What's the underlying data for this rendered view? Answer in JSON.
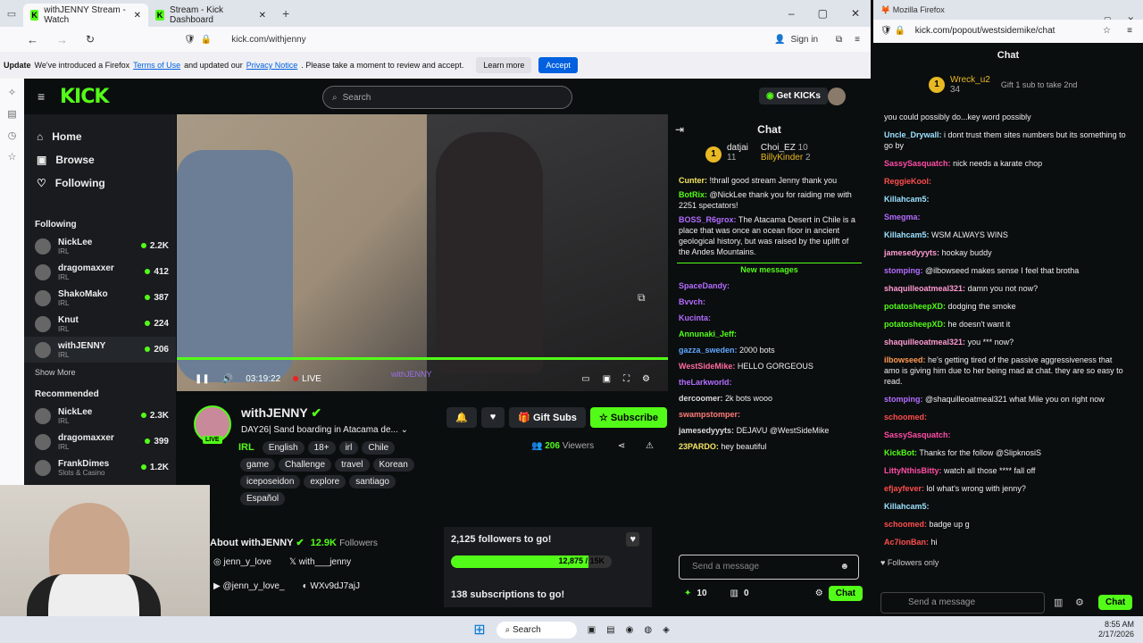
{
  "browser": {
    "tabs": [
      {
        "label": "withJENNY Stream - Watch"
      },
      {
        "label": "Stream - Kick Dashboard"
      }
    ],
    "url": "kick.com/withjenny",
    "sign_in": "Sign in",
    "notice": {
      "update": "Update",
      "text1": "We've introduced a Firefox",
      "terms": "Terms of Use",
      "text2": "and updated our",
      "privacy": "Privacy Notice",
      "text3": ". Please take a moment to review and accept.",
      "learn": "Learn more",
      "accept": "Accept"
    }
  },
  "kick": {
    "logo": "KICK",
    "search_placeholder": "Search",
    "getkicks": "Get KICKs",
    "nav": [
      {
        "label": "Home"
      },
      {
        "label": "Browse"
      },
      {
        "label": "Following"
      }
    ],
    "following_title": "Following",
    "following": [
      {
        "name": "NickLee",
        "cat": "IRL",
        "count": "2.2K"
      },
      {
        "name": "dragomaxxer",
        "cat": "IRL",
        "count": "412"
      },
      {
        "name": "ShakoMako",
        "cat": "IRL",
        "count": "387"
      },
      {
        "name": "Knut",
        "cat": "IRL",
        "count": "224"
      },
      {
        "name": "withJENNY",
        "cat": "IRL",
        "count": "206"
      }
    ],
    "show_more": "Show More",
    "recommended_title": "Recommended",
    "recommended": [
      {
        "name": "NickLee",
        "cat": "IRL",
        "count": "2.3K"
      },
      {
        "name": "dragomaxxer",
        "cat": "IRL",
        "count": "399"
      },
      {
        "name": "FrankDimes",
        "cat": "Slots & Casino",
        "count": "1.2K"
      }
    ],
    "player": {
      "time": "03:19:22",
      "live": "LIVE",
      "watermark": "withJENNY"
    },
    "stream": {
      "name": "withJENNY",
      "live_badge": "LIVE",
      "title": "DAY26| Sand boarding in Atacama de...",
      "category": "IRL",
      "tags": [
        "English",
        "18+",
        "irl",
        "Chile",
        "game",
        "Challenge",
        "travel",
        "Korean",
        "iceposeidon",
        "explore",
        "santiago",
        "Español"
      ],
      "viewers": "206",
      "viewers_label": "Viewers",
      "gift": "Gift Subs",
      "subscribe": "Subscribe"
    },
    "about": {
      "title": "About withJENNY",
      "followers": "12.9K",
      "followers_label": "Followers",
      "ig": "jenn_y_love",
      "x": "with___jenny",
      "yt": "@jenn_y_love_",
      "discord": "WXv9dJ7ajJ"
    },
    "goal": {
      "followers_text": "2,125 followers to go!",
      "progress_label": "12,875 / 15K",
      "progress": 0.858,
      "subs_text": "138 subscriptions to go!"
    },
    "chat": {
      "title": "Chat",
      "top": [
        {
          "name": "datjai",
          "n": "11"
        },
        {
          "name": "Choi_EZ",
          "n": "10"
        },
        {
          "name": "BillyKinder",
          "n": "2"
        }
      ],
      "messages": [
        {
          "user": "Cunter:",
          "text": "!thrall good stream Jenny thank you",
          "color": "#f5e663"
        },
        {
          "user": "BotRix:",
          "text": "@NickLee thank you for raiding me with 2251 spectators!",
          "color": "#53fc18"
        },
        {
          "user": "BOSS_R6grox:",
          "text": "The Atacama Desert in Chile is a place that was once an ocean floor in ancient geological history, but was raised by the uplift of the Andes Mountains.",
          "color": "#b36cff"
        }
      ],
      "new_messages": "New messages",
      "new": [
        {
          "user": "SpaceDandy:",
          "text": "",
          "color": "#b36cff"
        },
        {
          "user": "Bvvch:",
          "text": "",
          "color": "#b36cff"
        },
        {
          "user": "Kucinta:",
          "text": "",
          "color": "#b36cff"
        },
        {
          "user": "Annunaki_Jeff:",
          "text": "",
          "color": "#53fc18"
        },
        {
          "user": "gazza_sweden:",
          "text": "2000 bots",
          "color": "#5fa8ff"
        },
        {
          "user": "WestSideMike:",
          "text": "HELLO GORGEOUS",
          "color": "#ff6b9d"
        },
        {
          "user": "theLarkworld:",
          "text": "",
          "color": "#b36cff"
        },
        {
          "user": "dercoomer:",
          "text": "2k bots wooo",
          "color": "#ddd"
        },
        {
          "user": "swampstomper:",
          "text": "",
          "color": "#ff7a7a"
        },
        {
          "user": "jamesedyyyts:",
          "text": "DEJAVU @WestSideMike",
          "color": "#ddd"
        },
        {
          "user": "23PARDO:",
          "text": "hey beautiful",
          "color": "#f5e663"
        }
      ],
      "input_placeholder": "Send a message",
      "points": "10",
      "subs": "0",
      "send": "Chat"
    }
  },
  "popout": {
    "title": "Mozilla Firefox",
    "url": "kick.com/popout/westsidemike/chat",
    "chat_title": "Chat",
    "top_user": "Wreck_u2",
    "top_n": "34",
    "gift_text": "Gift 1 sub to take 2nd",
    "messages": [
      {
        "user": "",
        "text": "you could possibly do...key word possibly",
        "color": "#ddd"
      },
      {
        "user": "Uncle_Drywall:",
        "text": "i dont trust them sites numbers but its something to go by",
        "color": "#9be1ff"
      },
      {
        "user": "SassySasquatch:",
        "text": "nick needs a karate chop",
        "color": "#ff4da6"
      },
      {
        "user": "ReggieKool:",
        "text": "",
        "color": "#ff4d4d"
      },
      {
        "user": "Killahcam5:",
        "text": "",
        "color": "#9be1ff"
      },
      {
        "user": "Smegma:",
        "text": "",
        "color": "#b36cff"
      },
      {
        "user": "Killahcam5:",
        "text": "WSM ALWAYS WINS",
        "color": "#9be1ff"
      },
      {
        "user": "jamesedyyyts:",
        "text": "hookay buddy",
        "color": "#ff9bd2"
      },
      {
        "user": "stomping:",
        "text": "@ilbowseed makes sense I feel that brotha",
        "color": "#b36cff"
      },
      {
        "user": "shaquilleoatmeal321:",
        "text": "damn you not now?",
        "color": "#ff9bd2"
      },
      {
        "user": "potatosheepXD:",
        "text": "dodging the smoke",
        "color": "#53fc18"
      },
      {
        "user": "potatosheepXD:",
        "text": "he doesn't want it",
        "color": "#53fc18"
      },
      {
        "user": "shaquilleoatmeal321:",
        "text": "you *** now?",
        "color": "#ff9bd2"
      },
      {
        "user": "ilbowseed:",
        "text": "he's getting tired of the passive aggressiveness that amo is giving him due to her being mad at chat. they are so easy to read.",
        "color": "#ff9b54"
      },
      {
        "user": "stomping:",
        "text": "@shaquilleoatmeal321 what Mile you on right now",
        "color": "#b36cff"
      },
      {
        "user": "schoomed:",
        "text": "",
        "color": "#ff4d4d"
      },
      {
        "user": "SassySasquatch:",
        "text": "",
        "color": "#ff4da6"
      },
      {
        "user": "KickBot:",
        "text": "Thanks for the follow @SlipknosiS",
        "color": "#53fc18"
      },
      {
        "user": "LittyNthisBitty:",
        "text": "watch all those **** fall off",
        "color": "#ff4da6"
      },
      {
        "user": "efjayfever:",
        "text": "lol what's wrong with jenny?",
        "color": "#ff4d4d"
      },
      {
        "user": "Killahcam5:",
        "text": "",
        "color": "#9be1ff"
      },
      {
        "user": "schoomed:",
        "text": "badge up g",
        "color": "#ff4d4d"
      },
      {
        "user": "Ac7ionBan:",
        "text": "hi",
        "color": "#ff4d4d"
      }
    ],
    "followers_only": "Followers only",
    "input_placeholder": "Send a message",
    "send": "Chat"
  },
  "taskbar": {
    "search": "Search",
    "time": "8:55 AM",
    "date": "2/17/2026"
  }
}
